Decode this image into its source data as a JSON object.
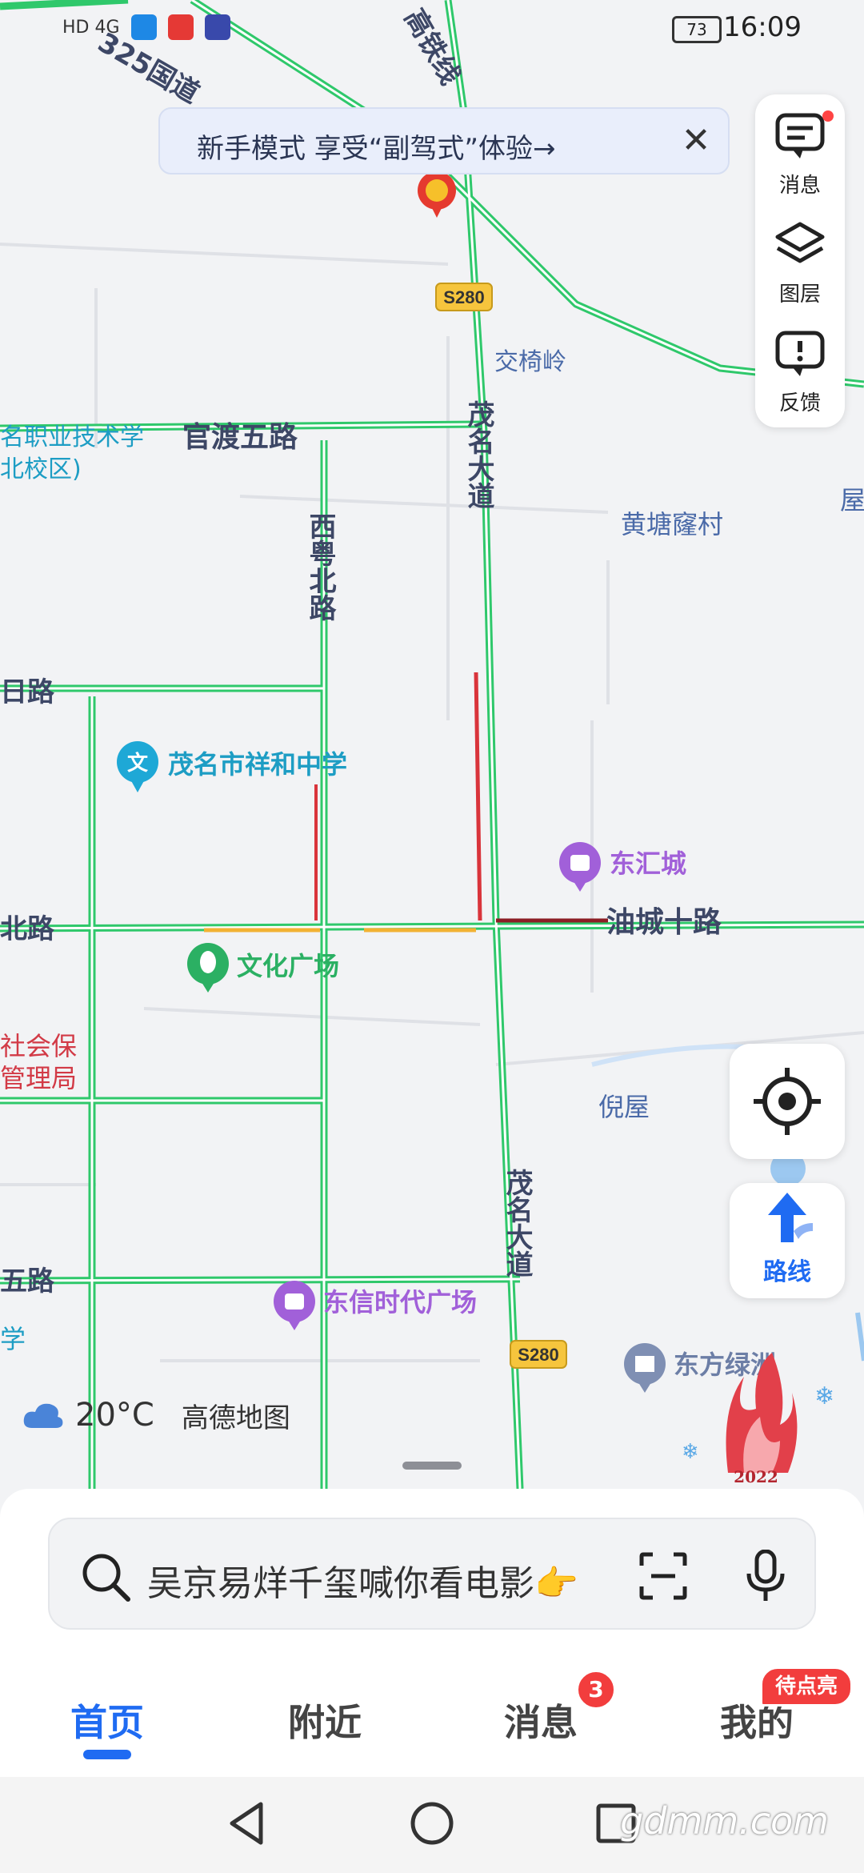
{
  "status_bar": {
    "left_indicators": "HD 4G",
    "battery": "73",
    "time": "16:09"
  },
  "banner": {
    "text": "新手模式  享受“副驾式”体验→"
  },
  "side_panel": {
    "items": [
      {
        "label": "消息",
        "icon": "message-icon"
      },
      {
        "label": "图层",
        "icon": "layers-icon"
      },
      {
        "label": "反馈",
        "icon": "feedback-icon"
      }
    ]
  },
  "map_labels": {
    "road_top_left": "325国道",
    "road_top_right": "高铁线",
    "route_badge_1": "S280",
    "route_badge_2": "S280",
    "jiaoyiling": "交椅岭",
    "guandu": "官渡五路",
    "school_cut": "名职业技术学",
    "school_cut2": "北校区)",
    "maoming_ave_1": "茂名大道",
    "maoming_ave_2": "茂名大道",
    "xiyue": "西粤北路",
    "huangtang": "黄塘窿村",
    "xiangming_school": "茂名市祥和中学",
    "donghui": "东汇城",
    "youcheng": "油城十路",
    "culture_square": "文化广场",
    "social_bureau_1": "社会保",
    "social_bureau_2": "管理局",
    "niwu": "倪屋",
    "dongxin": "东信时代广场",
    "dongfang": "东方绿洲",
    "edge_ri": "日路",
    "edge_bei": "北路",
    "edge_wu": "五路",
    "edge_xue": "学",
    "edge_wu2": "屋"
  },
  "locate_button": {
    "icon": "locate-icon"
  },
  "route_button": {
    "label": "路线",
    "icon": "route-arrow-icon"
  },
  "weather": {
    "icon": "cloud-icon",
    "temperature": "20°C",
    "brand": "高德地图"
  },
  "olympic_badge": {
    "year": "2022"
  },
  "search": {
    "placeholder": "吴京易烊千玺喊你看电影👉",
    "icons": [
      "search-icon",
      "scan-icon",
      "mic-icon"
    ]
  },
  "tabs": [
    {
      "label": "首页",
      "active": true
    },
    {
      "label": "附近",
      "active": false
    },
    {
      "label": "消息",
      "active": false,
      "badge": "3"
    },
    {
      "label": "我的",
      "active": false,
      "badge": "待点亮"
    }
  ],
  "nav_bar": {
    "icons": [
      "back-icon",
      "home-icon",
      "recents-icon"
    ],
    "watermark": "gdmm.com"
  },
  "colors": {
    "accent": "#1f6bf2",
    "road_green": "#2fc86b",
    "road_red": "#d9343b",
    "road_amber": "#f2b233",
    "badge_red": "#f23d3d"
  }
}
